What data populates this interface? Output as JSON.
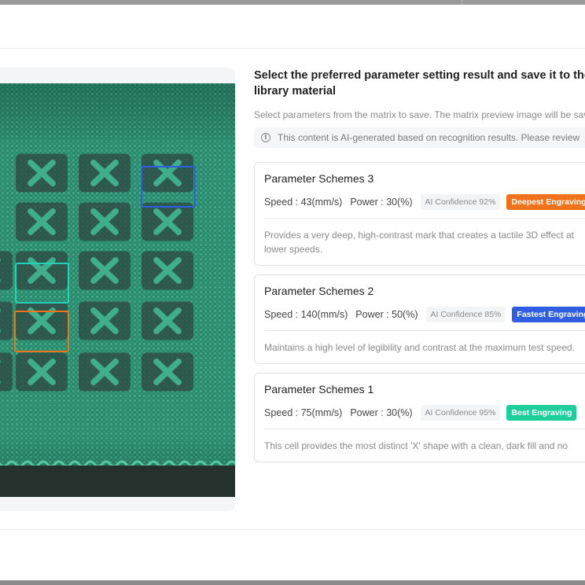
{
  "content": {
    "title": "Select the preferred parameter setting result and save it to the library material",
    "subtitle": "Select parameters from the matrix to save. The matrix preview image will be saved",
    "ai_notice": "This content is AI-generated based on recognition results. Please review"
  },
  "schemes": [
    {
      "name": "Parameter Schemes 3",
      "speed": "Speed : 43(mm/s)",
      "power": "Power : 30(%)",
      "confidence": "AI Confidence 92%",
      "tag": "Deepest Engraving",
      "tag_color": "#f0721b",
      "description": "Provides a very deep, high-contrast mark that creates a tactile 3D effect at lower speeds."
    },
    {
      "name": "Parameter Schemes 2",
      "speed": "Speed : 140(mm/s)",
      "power": "Power : 50(%)",
      "confidence": "AI Confidence 85%",
      "tag": "Fastest Engraving",
      "tag_color": "#2f5fe0",
      "description": "Maintains a high level of legibility and contrast at the maximum test speed."
    },
    {
      "name": "Parameter Schemes 1",
      "speed": "Speed : 75(mm/s)",
      "power": "Power : 30(%)",
      "confidence": "AI Confidence 95%",
      "tag": "Best Engraving",
      "tag_color": "#1ecf9c",
      "description": "This cell provides the most distinct 'X' shape with a clean, dark fill and no"
    }
  ],
  "matrix_highlights": [
    {
      "scheme": "Parameter Schemes 3",
      "color": "#2f5fe0"
    },
    {
      "scheme": "Parameter Schemes 1",
      "color": "#25d1b8"
    },
    {
      "scheme": "Parameter Schemes 2",
      "color": "#f0721b"
    }
  ],
  "icons": [
    "info-icon"
  ]
}
